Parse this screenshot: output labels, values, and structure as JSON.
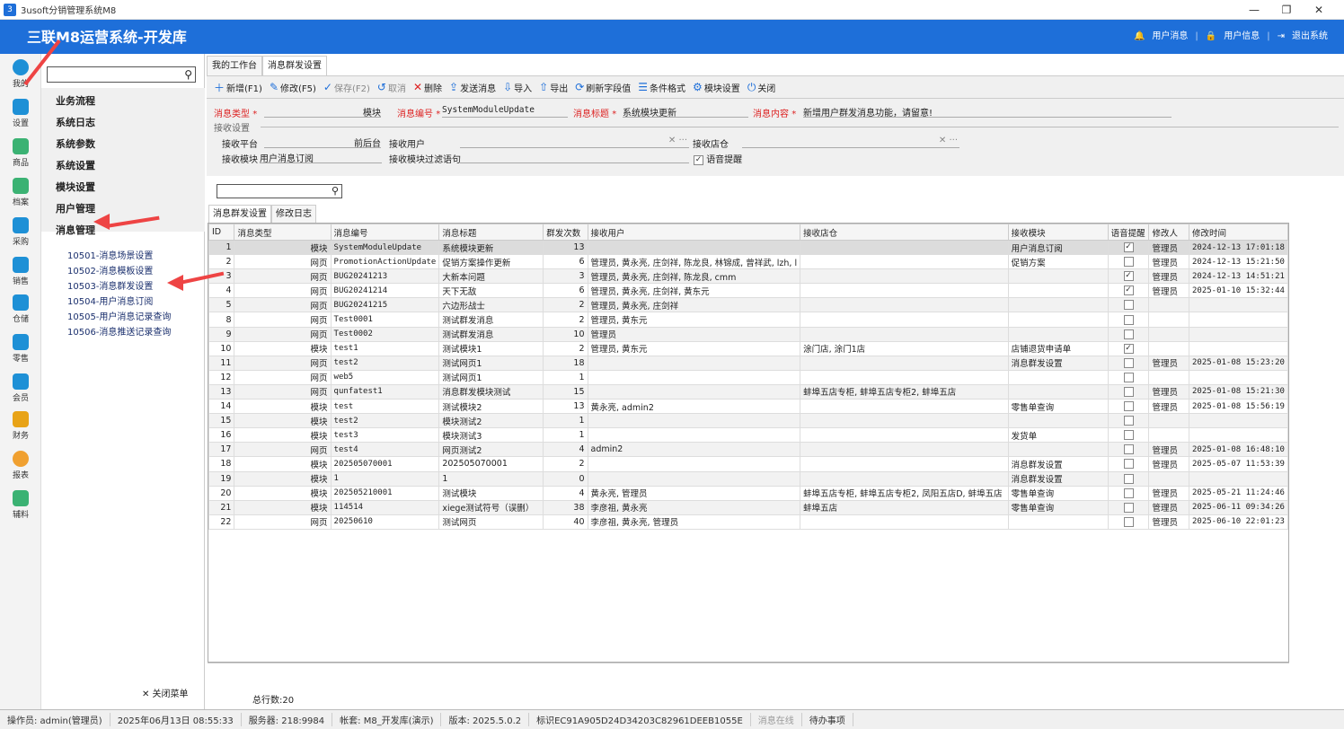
{
  "window": {
    "title": "3usoft分销管理系统M8",
    "min": "—",
    "max": "❐",
    "close": "✕"
  },
  "banner": {
    "title": "三联M8运营系统-开发库",
    "user_msg": "用户消息",
    "user_info": "用户信息",
    "logout": "退出系统",
    "sep": "|"
  },
  "iconbar": [
    {
      "label": "我的",
      "icon": "user-icon"
    },
    {
      "label": "设置",
      "icon": "gear-icon"
    },
    {
      "label": "商品",
      "icon": "cart-icon"
    },
    {
      "label": "档案",
      "icon": "folder-icon"
    },
    {
      "label": "采购",
      "icon": "purchase-icon"
    },
    {
      "label": "销售",
      "icon": "sales-icon"
    },
    {
      "label": "仓储",
      "icon": "warehouse-icon"
    },
    {
      "label": "零售",
      "icon": "retail-icon"
    },
    {
      "label": "会员",
      "icon": "crown-icon"
    },
    {
      "label": "财务",
      "icon": "money-icon"
    },
    {
      "label": "报表",
      "icon": "pie-chart-icon"
    },
    {
      "label": "辅料",
      "icon": "layers-icon"
    }
  ],
  "nav": {
    "search_placeholder": "",
    "items": [
      "业务流程",
      "系统日志",
      "系统参数",
      "系统设置",
      "模块设置",
      "用户管理",
      "消息管理"
    ],
    "subitems": [
      "10501-消息场景设置",
      "10502-消息模板设置",
      "10503-消息群发设置",
      "10504-用户消息订阅",
      "10505-用户消息记录查询",
      "10506-消息推送记录查询"
    ],
    "close_menu": "✕ 关闭菜单"
  },
  "tabs": [
    "我的工作台",
    "消息群发设置"
  ],
  "toolbar": [
    {
      "label": "新增(F1)",
      "icon": "＋",
      "disabled": false
    },
    {
      "label": "修改(F5)",
      "icon": "✎",
      "disabled": false
    },
    {
      "label": "保存(F2)",
      "icon": "✓",
      "disabled": true
    },
    {
      "label": "取消",
      "icon": "↺",
      "disabled": true
    },
    {
      "label": "删除",
      "icon": "✕",
      "disabled": false
    },
    {
      "label": "发送消息",
      "icon": "⇪",
      "disabled": false
    },
    {
      "label": "导入",
      "icon": "⇩",
      "disabled": false
    },
    {
      "label": "导出",
      "icon": "⇧",
      "disabled": false
    },
    {
      "label": "刷新字段值",
      "icon": "⟳",
      "disabled": false
    },
    {
      "label": "条件格式",
      "icon": "☰",
      "disabled": false
    },
    {
      "label": "模块设置",
      "icon": "⚙",
      "disabled": false
    },
    {
      "label": "关闭",
      "icon": "⏻",
      "disabled": false
    }
  ],
  "form": {
    "msg_type_label": "消息类型",
    "msg_type_value": "模块",
    "msg_code_label": "消息编号",
    "msg_code_value": "SystemModuleUpdate",
    "msg_title_label": "消息标题",
    "msg_title_value": "系统模块更新",
    "msg_content_label": "消息内容",
    "msg_content_value": "新增用户群发消息功能，请留意!",
    "receive_group": "接收设置",
    "platform_label": "接收平台",
    "platform_value": "前后台",
    "recv_user_label": "接收用户",
    "recv_store_label": "接收店仓",
    "module_label": "接收模块",
    "module_value": "用户消息订阅",
    "filter_label": "接收模块过滤语句",
    "voice_label": "语音提醒",
    "star": "*"
  },
  "subtabs": [
    "消息群发设置",
    "修改日志"
  ],
  "grid": {
    "columns": [
      "ID",
      "消息类型",
      "消息编号",
      "消息标题",
      "群发次数",
      "接收用户",
      "接收店仓",
      "接收模块",
      "语音提醒",
      "修改人",
      "修改时间"
    ],
    "rows": [
      [
        "1",
        "模块",
        "SystemModuleUpdate",
        "系统模块更新",
        "13",
        "",
        "",
        "用户消息订阅",
        "1",
        "管理员",
        "2024-12-13 17:01:18"
      ],
      [
        "2",
        "网页",
        "PromotionActionUpdate",
        "促销方案操作更新",
        "6",
        "管理员, 黄永亮, 庄剑祥, 陈龙良, 林锦成, 曾祥武, lzh, l",
        "",
        "促销方案",
        "0",
        "管理员",
        "2024-12-13 15:21:50"
      ],
      [
        "3",
        "网页",
        "BUG20241213",
        "大新本问题",
        "3",
        "管理员, 黄永亮, 庄剑祥, 陈龙良, cmm",
        "",
        "",
        "1",
        "管理员",
        "2024-12-13 14:51:21"
      ],
      [
        "4",
        "网页",
        "BUG20241214",
        "天下无敌",
        "6",
        "管理员, 黄永亮, 庄剑祥, 黄东元",
        "",
        "",
        "1",
        "管理员",
        "2025-01-10 15:32:44"
      ],
      [
        "5",
        "网页",
        "BUG20241215",
        "六边形战士",
        "2",
        "管理员, 黄永亮, 庄剑祥",
        "",
        "",
        "0",
        "",
        ""
      ],
      [
        "8",
        "网页",
        "Test0001",
        "测试群发消息",
        "2",
        "管理员, 黄东元",
        "",
        "",
        "0",
        "",
        ""
      ],
      [
        "9",
        "网页",
        "Test0002",
        "测试群发消息",
        "10",
        "管理员",
        "",
        "",
        "0",
        "",
        ""
      ],
      [
        "10",
        "模块",
        "test1",
        "测试模块1",
        "2",
        "管理员, 黄东元",
        "涂门店, 涂门1店",
        "店铺退货申请单",
        "1",
        "",
        ""
      ],
      [
        "11",
        "网页",
        "test2",
        "测试网页1",
        "18",
        "",
        "",
        "消息群发设置",
        "0",
        "管理员",
        "2025-01-08 15:23:20"
      ],
      [
        "12",
        "网页",
        "web5",
        "测试网页1",
        "1",
        "",
        "",
        "",
        "0",
        "",
        ""
      ],
      [
        "13",
        "网页",
        "qunfatest1",
        "消息群发模块测试",
        "15",
        "",
        "蚌埠五店专柜, 蚌埠五店专柜2, 蚌埠五店",
        "",
        "0",
        "管理员",
        "2025-01-08 15:21:30"
      ],
      [
        "14",
        "模块",
        "test",
        "测试模块2",
        "13",
        "黄永亮, admin2",
        "",
        "零售单查询",
        "0",
        "管理员",
        "2025-01-08 15:56:19"
      ],
      [
        "15",
        "模块",
        "test2",
        "模块测试2",
        "1",
        "",
        "",
        "",
        "0",
        "",
        ""
      ],
      [
        "16",
        "模块",
        "test3",
        "模块测试3",
        "1",
        "",
        "",
        "发货单",
        "0",
        "",
        ""
      ],
      [
        "17",
        "网页",
        "test4",
        "网页测试2",
        "4",
        "admin2",
        "",
        "",
        "0",
        "管理员",
        "2025-01-08 16:48:10"
      ],
      [
        "18",
        "模块",
        "202505070001",
        "202505070001",
        "2",
        "",
        "",
        "消息群发设置",
        "0",
        "管理员",
        "2025-05-07 11:53:39"
      ],
      [
        "19",
        "模块",
        "1",
        "1",
        "0",
        "",
        "",
        "消息群发设置",
        "0",
        "",
        ""
      ],
      [
        "20",
        "模块",
        "202505210001",
        "测试模块",
        "4",
        "黄永亮, 管理员",
        "蚌埠五店专柜, 蚌埠五店专柜2, 凤阳五店D, 蚌埠五店",
        "零售单查询",
        "0",
        "管理员",
        "2025-05-21 11:24:46"
      ],
      [
        "21",
        "模块",
        "114514",
        "xiege测试符号（误删）",
        "38",
        "李彦祖, 黄永亮",
        "蚌埠五店",
        "零售单查询",
        "0",
        "管理员",
        "2025-06-11 09:34:26"
      ],
      [
        "22",
        "网页",
        "20250610",
        "测试网页",
        "40",
        "李彦祖, 黄永亮, 管理员",
        "",
        "",
        "0",
        "管理员",
        "2025-06-10 22:01:23"
      ]
    ],
    "total": "总行数:20"
  },
  "status": [
    "操作员: admin(管理员)",
    "2025年06月13日 08:55:33",
    "服务器: 218:9984",
    "帐套: M8_开发库(演示)",
    "版本: 2025.5.0.2",
    "标识EC91A905D24D34203C82961DEEB1055E",
    "消息在线",
    "待办事项"
  ],
  "colors": {
    "accent": "#1e6fd9",
    "arrow": "#ee4444",
    "required": "#dd2222"
  }
}
